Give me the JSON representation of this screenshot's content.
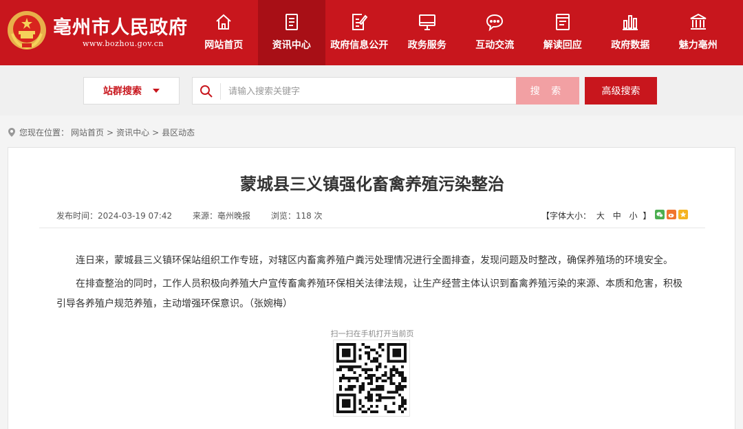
{
  "header": {
    "site_name": "亳州市人民政府",
    "site_url": "www.bozhou.gov.cn",
    "brand_color": "#c8161d",
    "nav": [
      {
        "label": "网站首页",
        "icon": "home-icon"
      },
      {
        "label": "资讯中心",
        "icon": "news-icon",
        "active": true
      },
      {
        "label": "政府信息公开",
        "icon": "document-edit-icon"
      },
      {
        "label": "政务服务",
        "icon": "monitor-icon"
      },
      {
        "label": "互动交流",
        "icon": "chat-icon"
      },
      {
        "label": "解读回应",
        "icon": "book-icon"
      },
      {
        "label": "政府数据",
        "icon": "bar-chart-icon"
      },
      {
        "label": "魅力亳州",
        "icon": "landmark-icon"
      }
    ]
  },
  "search": {
    "scope_label": "站群搜索",
    "placeholder": "请输入搜索关键字",
    "search_label": "搜 索",
    "advanced_label": "高级搜索"
  },
  "breadcrumb": {
    "prefix": "您现在位置：",
    "items": [
      "网站首页",
      "资讯中心",
      "县区动态"
    ],
    "separator": ">"
  },
  "article": {
    "title": "蒙城县三义镇强化畜禽养殖污染整治",
    "publish_time": "发布时间：2024-03-19 07:42",
    "source": "来源：亳州晚报",
    "views": "浏览：118 次",
    "font_size_label": "【字体大小：",
    "font_sizes": [
      "大",
      "中",
      "小"
    ],
    "font_size_close": "】",
    "paragraphs": [
      "连日来，蒙城县三义镇环保站组织工作专班，对辖区内畜禽养殖户粪污处理情况进行全面排查，发现问题及时整改，确保养殖场的环境安全。",
      "在排查整治的同时，工作人员积极向养殖大户宣传畜禽养殖环保相关法律法规，让生产经营主体认识到畜禽养殖污染的来源、本质和危害，积极引导各养殖户规范养殖，主动增强环保意识。（张婉梅）"
    ],
    "qr_caption": "扫一扫在手机打开当前页"
  }
}
